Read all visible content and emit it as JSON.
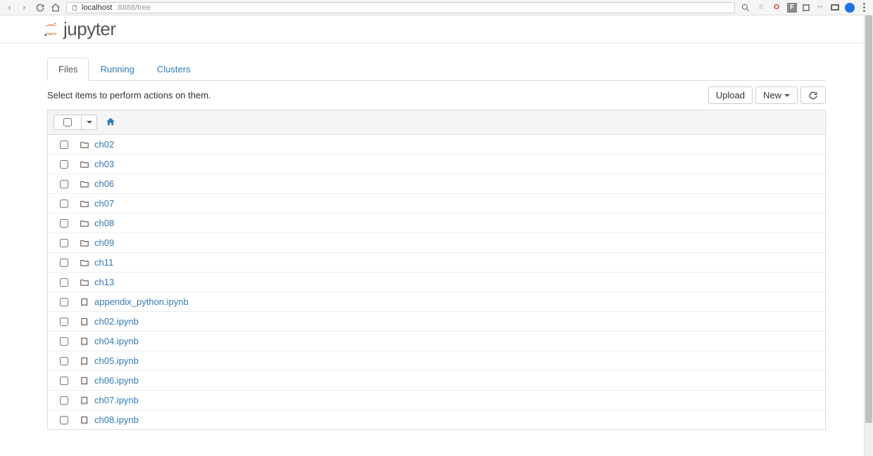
{
  "browser": {
    "url_host": "localhost",
    "url_port_path": ":8888/tree"
  },
  "logo_text": "jupyter",
  "tabs": {
    "files": "Files",
    "running": "Running",
    "clusters": "Clusters"
  },
  "hint": "Select items to perform actions on them.",
  "toolbar": {
    "upload": "Upload",
    "new": "New"
  },
  "items": [
    {
      "type": "folder",
      "name": "ch02"
    },
    {
      "type": "folder",
      "name": "ch03"
    },
    {
      "type": "folder",
      "name": "ch06"
    },
    {
      "type": "folder",
      "name": "ch07"
    },
    {
      "type": "folder",
      "name": "ch08"
    },
    {
      "type": "folder",
      "name": "ch09"
    },
    {
      "type": "folder",
      "name": "ch11"
    },
    {
      "type": "folder",
      "name": "ch13"
    },
    {
      "type": "notebook",
      "name": "appendix_python.ipynb"
    },
    {
      "type": "notebook",
      "name": "ch02.ipynb"
    },
    {
      "type": "notebook",
      "name": "ch04.ipynb"
    },
    {
      "type": "notebook",
      "name": "ch05.ipynb"
    },
    {
      "type": "notebook",
      "name": "ch06.ipynb"
    },
    {
      "type": "notebook",
      "name": "ch07.ipynb"
    },
    {
      "type": "notebook",
      "name": "ch08.ipynb"
    }
  ]
}
